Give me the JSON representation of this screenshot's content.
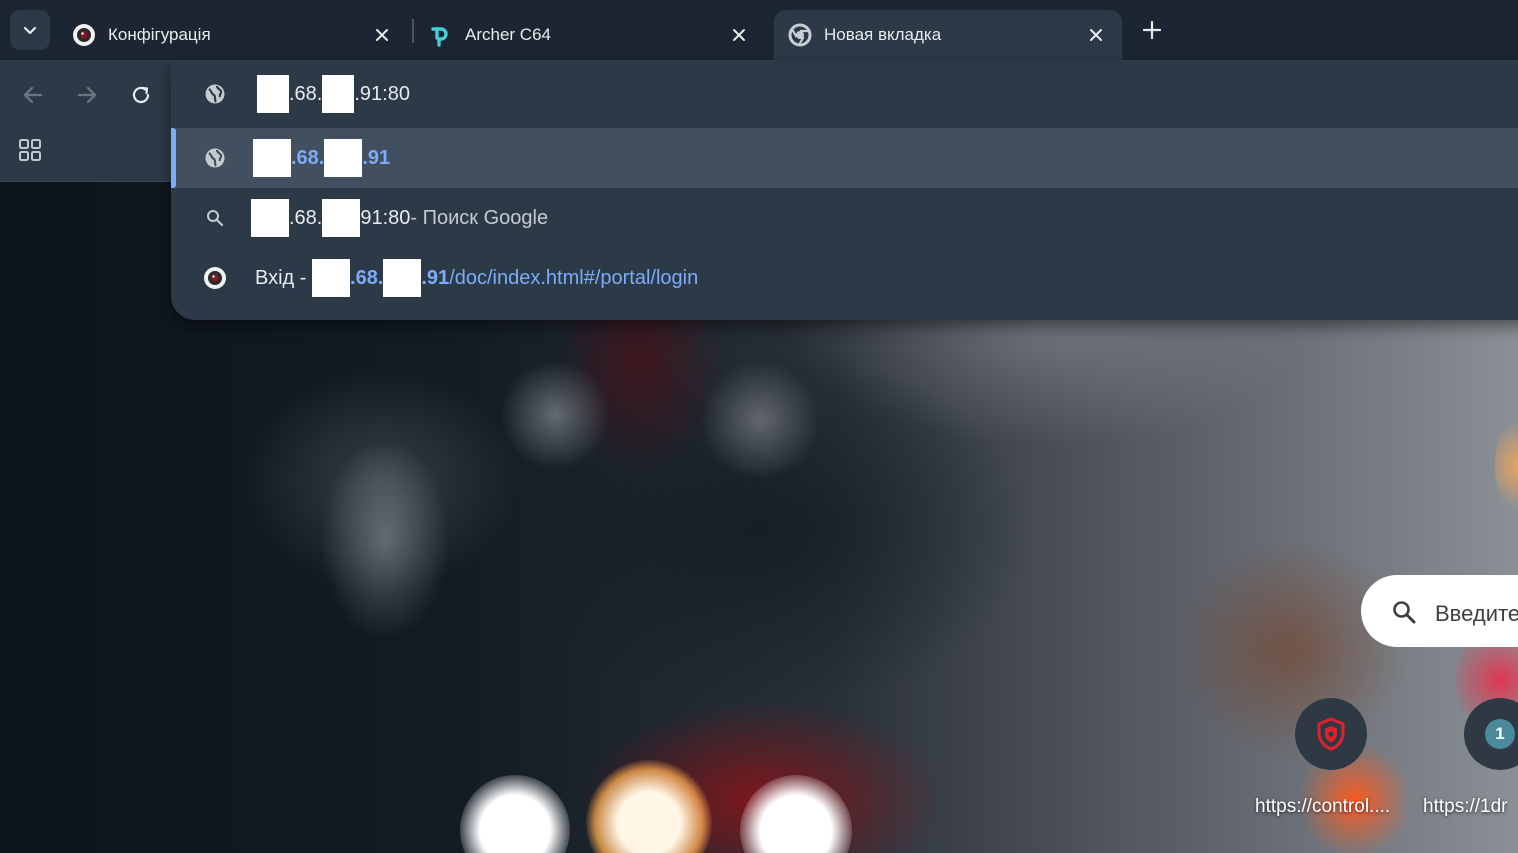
{
  "tabs": [
    {
      "title": "Конфігурація",
      "favicon": "camera-icon",
      "active": false
    },
    {
      "title": "Archer C64",
      "favicon": "tplink-icon",
      "active": false
    },
    {
      "title": "Новая вкладка",
      "favicon": "chrome-icon",
      "active": true
    }
  ],
  "toolbar": {
    "back_icon": "arrow-left-icon",
    "forward_icon": "arrow-right-icon",
    "reload_icon": "reload-icon",
    "apps_icon": "apps-grid-icon"
  },
  "omnibox": {
    "suggestions": [
      {
        "icon": "globe-icon",
        "parts": [
          "",
          ".68.",
          ".91:80"
        ],
        "suffix": "",
        "selected": false
      },
      {
        "icon": "globe-icon",
        "parts": [
          "",
          ".68.",
          ".91"
        ],
        "suffix": "",
        "selected": true
      },
      {
        "icon": "search-icon",
        "parts": [
          "",
          ".68.",
          "91:80"
        ],
        "suffix": " - Поиск Google",
        "selected": false
      },
      {
        "icon": "camera-icon",
        "prefix": "Вхід - ",
        "parts": [
          "",
          ".68.",
          ".91"
        ],
        "path": "/doc/index.html#/portal/login",
        "selected": false
      }
    ]
  },
  "ntp": {
    "search_placeholder": "Введите",
    "shortcuts": [
      {
        "label": "https://control....",
        "icon": "shield-icon"
      },
      {
        "label": "https://1dr",
        "icon": "badge-1-icon",
        "badge": "1"
      }
    ]
  },
  "colors": {
    "accent": "#7cacf8",
    "toolbar_bg": "#2c3a48",
    "tabstrip_bg": "#1b2632",
    "selected_row_bg": "#424f5e"
  }
}
